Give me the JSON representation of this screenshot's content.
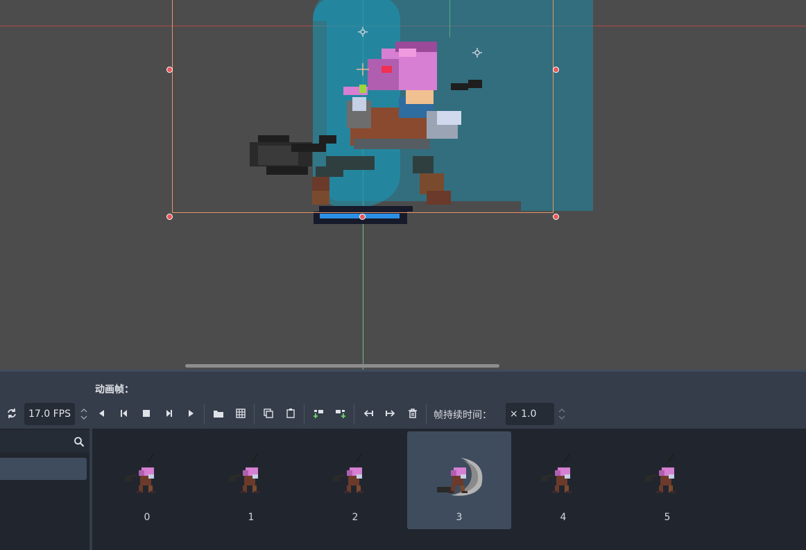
{
  "panel": {
    "title": "动画帧：",
    "fps_value": "17.0 FPS",
    "frame_duration_label": "帧持续时间：",
    "frame_duration_value": "× 1.0"
  },
  "toolbar": {
    "icons": [
      "loop-icon",
      "play-backwards-icon",
      "play-backwards-from-start-icon",
      "stop-icon",
      "play-from-start-icon",
      "play-icon",
      "load-frames-icon",
      "sprite-sheet-icon",
      "copy-icon",
      "paste-icon",
      "insert-before-icon",
      "insert-after-icon",
      "move-left-icon",
      "move-right-icon",
      "delete-icon"
    ]
  },
  "frames": [
    {
      "label": "0",
      "selected": false
    },
    {
      "label": "1",
      "selected": false
    },
    {
      "label": "2",
      "selected": false
    },
    {
      "label": "3",
      "selected": true
    },
    {
      "label": "4",
      "selected": false
    },
    {
      "label": "5",
      "selected": false
    }
  ],
  "colors": {
    "accent": "#3e4c5e",
    "selection_rect": "#e8966a",
    "handle": "#e9585a",
    "collision_fill": "#1a8aa8",
    "progress": "#2c8fe6",
    "hair": "#d77fd3"
  }
}
